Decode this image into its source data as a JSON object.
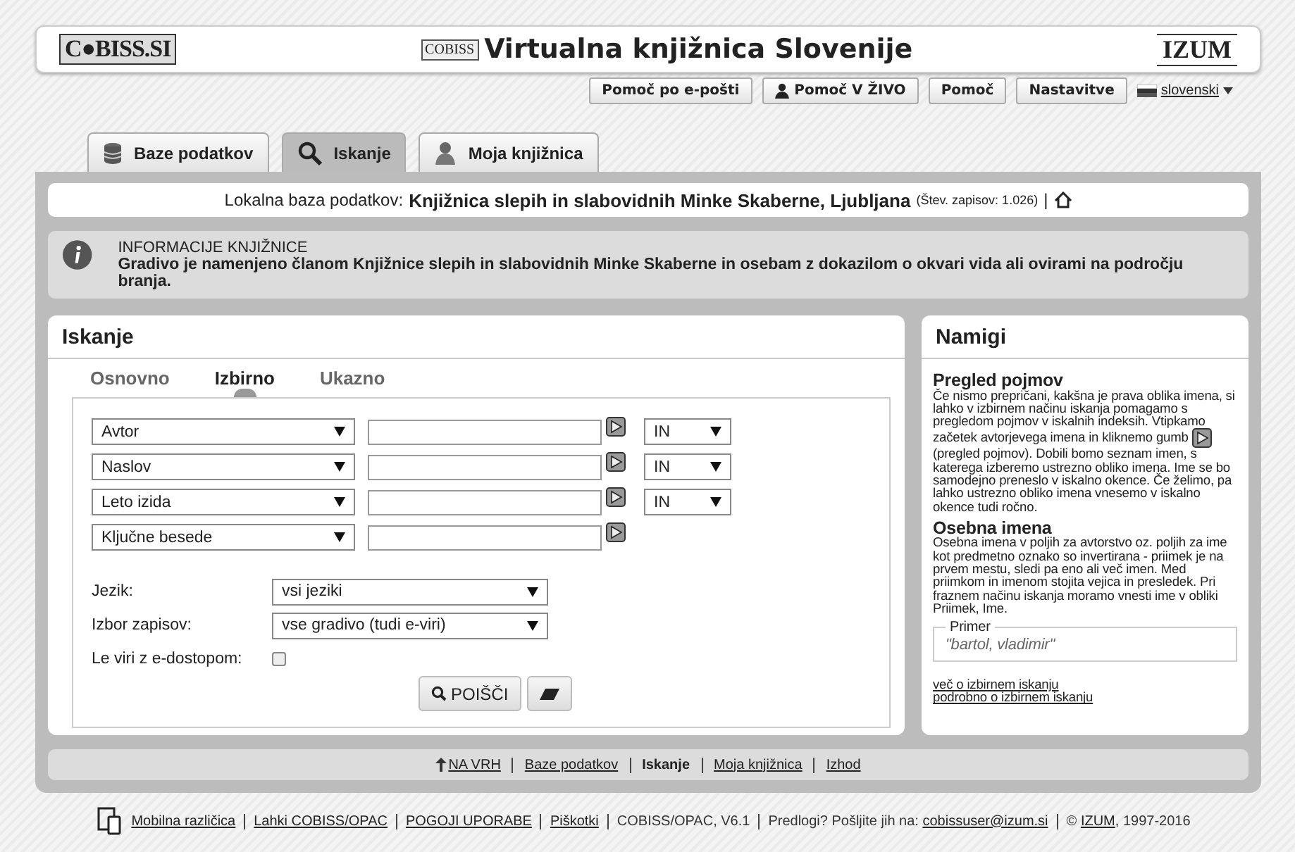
{
  "header": {
    "left_logo": "C●BISS.SI",
    "title_logo": "COBISS",
    "title": "Virtualna knjižnica Slovenije",
    "right_logo": "IZUM"
  },
  "top_buttons": [
    {
      "label": "Pomoč po e-pošti",
      "kind": "plain"
    },
    {
      "label": "Pomoč V ŽIVO",
      "kind": "person"
    },
    {
      "label": "Pomoč",
      "kind": "plain"
    },
    {
      "label": "Nastavitve",
      "kind": "plain"
    }
  ],
  "language": {
    "label": "slovenski"
  },
  "tabs": [
    {
      "label": "Baze podatkov",
      "kind": "database",
      "selected": false
    },
    {
      "label": "Iskanje",
      "kind": "search",
      "selected": true
    },
    {
      "label": "Moja knjižnica",
      "kind": "person",
      "selected": false
    }
  ],
  "database_bar": {
    "label": "Lokalna baza podatkov:",
    "name": "Knjižnica slepih in slabovidnih Minke Skaberne, Ljubljana",
    "count": "(Štev. zapisov: 1.026)",
    "separator": "|"
  },
  "info": {
    "title": "INFORMACIJE KNJIŽNICE",
    "text": "Gradivo je namenjeno članom Knjižnice slepih in slabovidnih Minke Skaberne in osebam z dokazilom o okvari vida ali ovirami na področju branja."
  },
  "search_panel": {
    "title": "Iskanje",
    "modes": [
      {
        "label": "Osnovno",
        "selected": false
      },
      {
        "label": "Izbirno",
        "selected": true
      },
      {
        "label": "Ukazno",
        "selected": false
      }
    ],
    "rows": [
      {
        "field": "Avtor",
        "operator": "IN"
      },
      {
        "field": "Naslov",
        "operator": "IN"
      },
      {
        "field": "Leto izida",
        "operator": "IN"
      },
      {
        "field": "Ključne besede"
      }
    ],
    "filters": [
      {
        "label": "Jezik:",
        "value": "vsi jeziki"
      },
      {
        "label": "Izbor zapisov:",
        "value": "vse gradivo (tudi e-viri)"
      }
    ],
    "e_access": {
      "label": "Le viri z e-dostopom:",
      "checked": false
    },
    "search_button": "POIŠČI"
  },
  "hints_panel": {
    "title": "Namigi",
    "sections": [
      {
        "heading": "Pregled pojmov",
        "text_before": "Če nismo prepričani, kakšna je prava oblika imena, si lahko v izbirnem načinu iskanja pomagamo s pregledom pojmov v iskalnih indeksih. Vtipkamo začetek avtorjevega imena in kliknemo gumb",
        "text_after": "(pregled pojmov). Dobili bomo seznam imen, s katerega izberemo ustrezno obliko imena. Ime se bo samodejno preneslo v iskalno okence. Če želimo, pa lahko ustrezno obliko imena vnesemo v iskalno okence tudi ročno."
      },
      {
        "heading": "Osebna imena",
        "text_before": "Osebna imena v poljih za avtorstvo oz. poljih za ime kot predmetno oznako so invertirana - priimek je na prvem mestu, sledi pa eno ali več imen. Med priimkom in imenom stojita vejica in presledek. Pri fraznem načinu iskanja moramo vnesti ime v obliki Priimek, Ime."
      }
    ],
    "example": {
      "legend": "Primer",
      "text": "\"bartol, vladimir\""
    },
    "links": [
      "več o izbirnem iskanju",
      "podrobno o izbirnem iskanju"
    ]
  },
  "bottom_nav": [
    {
      "label": "NA VRH",
      "kind": "top",
      "link": true
    },
    {
      "label": "Baze podatkov",
      "kind": "plain",
      "link": true
    },
    {
      "label": "Iskanje",
      "kind": "plain",
      "link": false
    },
    {
      "label": "Moja knjižnica",
      "kind": "plain",
      "link": true
    },
    {
      "label": "Izhod",
      "kind": "plain",
      "link": true
    }
  ],
  "footer": [
    {
      "kind": "link",
      "text": "Mobilna različica"
    },
    {
      "kind": "link",
      "text": "Lahki COBISS/OPAC"
    },
    {
      "kind": "link",
      "text": "POGOJI UPORABE"
    },
    {
      "kind": "link",
      "text": "Piškotki"
    },
    {
      "kind": "text",
      "text": "COBISS/OPAC, V6.1"
    },
    {
      "kind": "mixed",
      "before": "Predlogi? Pošljite jih na:",
      "link": "cobissuser@izum.si"
    },
    {
      "kind": "mixed",
      "before": "©",
      "link": "IZUM",
      "after": ", 1997-2016"
    }
  ]
}
